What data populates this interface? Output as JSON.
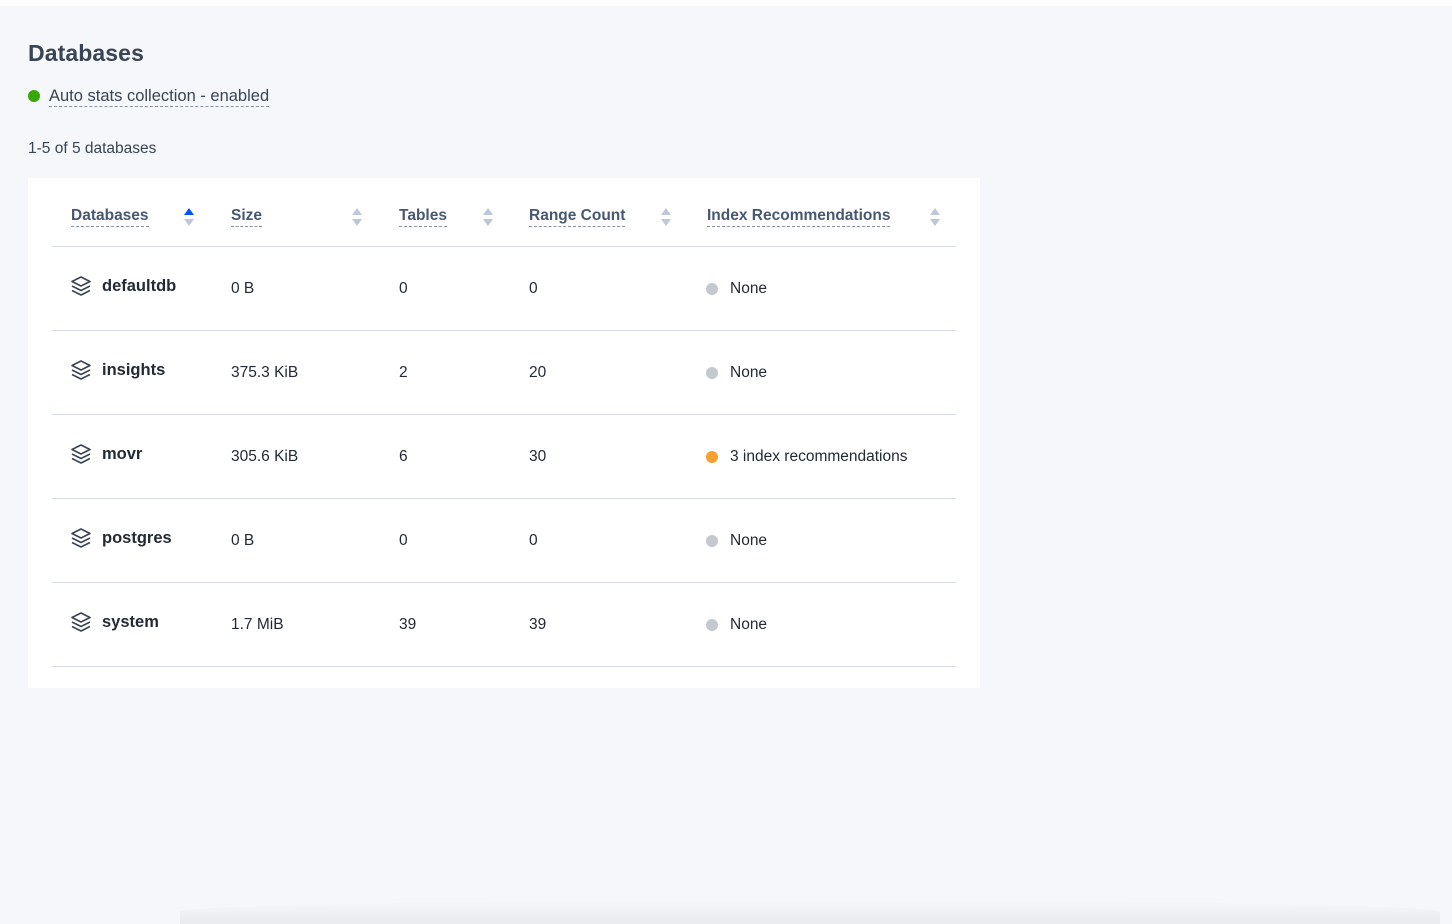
{
  "page": {
    "title": "Databases",
    "auto_stats_label": "Auto stats collection - enabled",
    "count_text": "1-5 of 5 databases"
  },
  "colors": {
    "stats_enabled": "#37a806",
    "recommendation_none": "#c4c8cf",
    "recommendation_warning": "#f5a02f",
    "sort_active": "#0055ff",
    "sort_inactive": "#c0c6d9"
  },
  "table": {
    "columns": [
      {
        "label": "Databases",
        "sort": "asc"
      },
      {
        "label": "Size",
        "sort": "none"
      },
      {
        "label": "Tables",
        "sort": "none"
      },
      {
        "label": "Range Count",
        "sort": "none"
      },
      {
        "label": "Index Recommendations",
        "sort": "none"
      }
    ],
    "rows": [
      {
        "name": "defaultdb",
        "size": "0 B",
        "tables": "0",
        "range_count": "0",
        "index_recommendation": "None",
        "recommendation_status": "none"
      },
      {
        "name": "insights",
        "size": "375.3 KiB",
        "tables": "2",
        "range_count": "20",
        "index_recommendation": "None",
        "recommendation_status": "none"
      },
      {
        "name": "movr",
        "size": "305.6 KiB",
        "tables": "6",
        "range_count": "30",
        "index_recommendation": "3 index recommendations",
        "recommendation_status": "warning"
      },
      {
        "name": "postgres",
        "size": "0 B",
        "tables": "0",
        "range_count": "0",
        "index_recommendation": "None",
        "recommendation_status": "none"
      },
      {
        "name": "system",
        "size": "1.7 MiB",
        "tables": "39",
        "range_count": "39",
        "index_recommendation": "None",
        "recommendation_status": "none"
      }
    ]
  },
  "icons": {
    "database": "database-stack-icon",
    "sort": "sort-arrows-icon",
    "status": "status-dot"
  }
}
